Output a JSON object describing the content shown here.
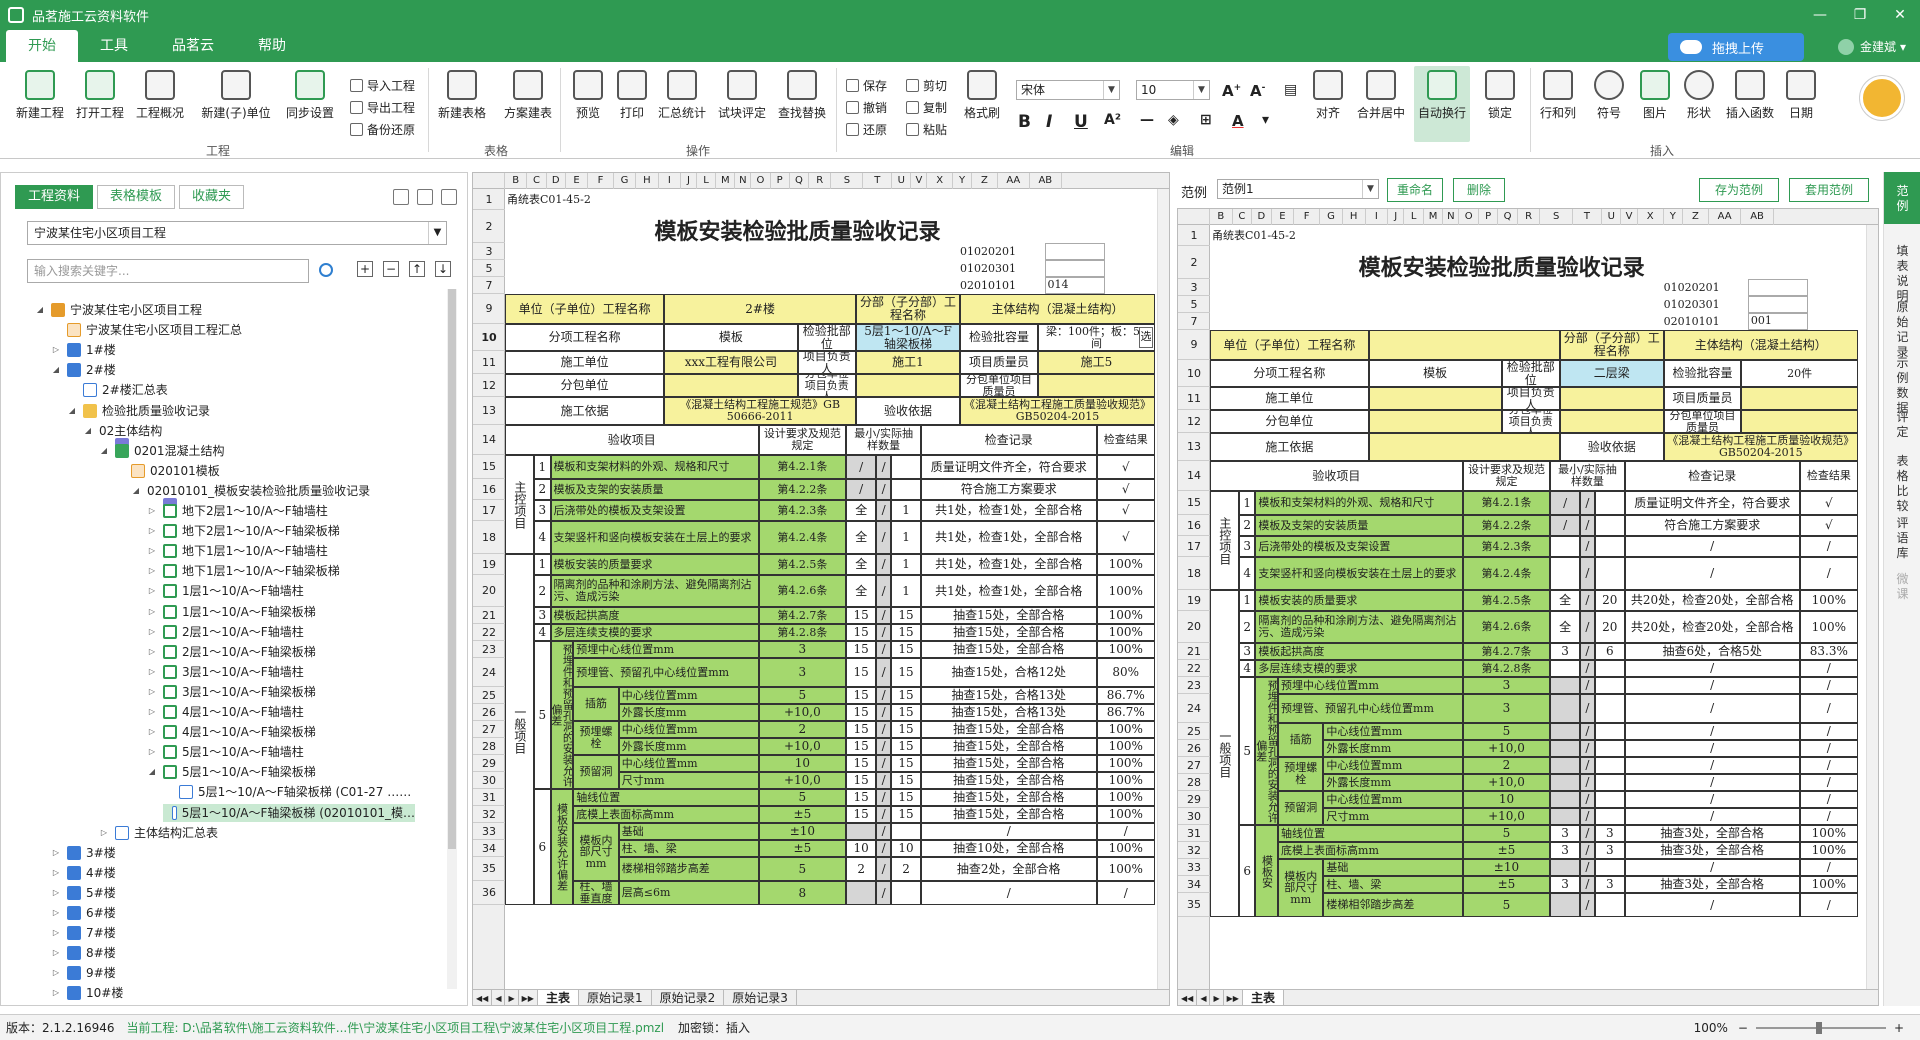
{
  "app": {
    "title": "品茗施工云资料软件"
  },
  "menu": {
    "tabs": [
      "开始",
      "工具",
      "品茗云",
      "帮助"
    ]
  },
  "upload": {
    "label": "拖拽上传"
  },
  "user": {
    "name": "金建斌"
  },
  "ribbon": {
    "big_buttons": [
      "新建工程",
      "打开工程",
      "工程概况",
      "新建(子)单位",
      "同步设置",
      "新建表格",
      "方案建表",
      "预览",
      "打印",
      "汇总统计",
      "试块评定",
      "查找替换",
      "格式刷",
      "对齐",
      "合并居中",
      "自动换行",
      "锁定",
      "行和列",
      "符号",
      "图片",
      "形状",
      "插入函数",
      "日期"
    ],
    "small_buttons": [
      "导入工程",
      "导出工程",
      "备份还原",
      "保存",
      "撤销",
      "还原",
      "剪切",
      "复制",
      "粘贴"
    ],
    "groups": [
      "工程",
      "表格",
      "操作",
      "编辑",
      "插入"
    ],
    "font_name": "宋体",
    "font_size": "10"
  },
  "left": {
    "tabs": [
      "工程资料",
      "表格模板",
      "收藏夹"
    ],
    "project": "宁波某住宅小区项目工程",
    "search_placeholder": "输入搜索关键字...",
    "tree": [
      "宁波某住宅小区项目工程",
      "宁波某住宅小区项目工程汇总",
      "1#楼",
      "2#楼",
      "2#楼汇总表",
      "检验批质量验收记录",
      "02主体结构",
      "0201混凝土结构",
      "020101模板",
      "02010101_模板安装检验批质量验收记录",
      "地下2层1～10/A～F轴墙柱",
      "地下2层1～10/A～F轴梁板梯",
      "地下1层1～10/A～F轴墙柱",
      "地下1层1～10/A～F轴梁板梯",
      "1层1～10/A～F轴墙柱",
      "1层1～10/A～F轴梁板梯",
      "2层1～10/A～F轴墙柱",
      "2层1～10/A～F轴梁板梯",
      "3层1～10/A～F轴墙柱",
      "3层1～10/A～F轴梁板梯",
      "4层1～10/A～F轴墙柱",
      "4层1～10/A～F轴梁板梯",
      "5层1～10/A～F轴墙柱",
      "5层1～10/A～F轴梁板梯",
      "5层1～10/A～F轴梁板梯 (C01-27 ……",
      "5层1～10/A～F轴梁板梯 (02010101_模…",
      "主体结构汇总表",
      "3#楼",
      "4#楼",
      "5#楼",
      "6#楼",
      "7#楼",
      "8#楼",
      "9#楼",
      "10#楼"
    ]
  },
  "sheetA": {
    "cols": [
      "B",
      "C",
      "D",
      "E",
      "F",
      "G",
      "H",
      "I",
      "J",
      "L",
      "M",
      "N",
      "O",
      "P",
      "Q",
      "R",
      "S",
      "T",
      "U",
      "V",
      "X",
      "Y",
      "Z",
      "AA",
      "AB"
    ],
    "rows": [
      "1",
      "2",
      "3",
      "5",
      "7",
      "9",
      "10",
      "11",
      "12",
      "13",
      "14",
      "15",
      "16",
      "17",
      "18",
      "19",
      "20",
      "21",
      "22",
      "23",
      "24",
      "25",
      "26",
      "27",
      "28",
      "29",
      "30",
      "31",
      "32",
      "33",
      "34",
      "35",
      "36"
    ],
    "code": "甬统表C01-45-2",
    "title": "模板安装检验批质量验收记录",
    "codes": [
      "01020201",
      "01020301",
      "02010101"
    ],
    "code_val": "014",
    "unit_lbl": "单位（子单位）工程名称",
    "unit_val": "2#楼",
    "sub_lbl": "分部（子分部）工程名称",
    "sub_val": "主体结构（混凝土结构）",
    "item_lbl": "分项工程名称",
    "item_val": "模板",
    "part_lbl": "检验批部位",
    "part_val": "5层1～10/A～F轴梁板梯",
    "cap_lbl": "检验批容量",
    "cap_val": "梁：100件；板：50间",
    "cap_btn": "选",
    "cons_lbl": "施工单位",
    "cons_val": "xxx工程有限公司",
    "pm_lbl": "项目负责人",
    "pm_val": "施工1",
    "qm_lbl": "项目质量员",
    "qm_val": "施工5",
    "subc_lbl": "分包单位",
    "subc_pm_lbl": "分包单位项目负责人",
    "subc_qm_lbl": "分包单位项目质量员",
    "basis_lbl": "施工依据",
    "basis_val": "《混凝土结构工程施工规范》GB 50666-2011",
    "accept_lbl": "验收依据",
    "accept_val": "《混凝土结构工程施工质量验收规范》GB50204-2015",
    "hdr": [
      "验收项目",
      "设计要求及规范规定",
      "最小/实际抽样数量",
      "检查记录",
      "检查结果"
    ],
    "main_lbl": "主控项目",
    "gen_lbl": "一般项目",
    "items": [
      [
        "1",
        "模板和支架材料的外观、规格和尺寸",
        "第4.2.1条",
        "/",
        "",
        "质量证明文件齐全，符合要求",
        "√"
      ],
      [
        "2",
        "模板及支架的安装质量",
        "第4.2.2条",
        "/",
        "",
        "符合施工方案要求",
        "√"
      ],
      [
        "3",
        "后浇带处的模板及支架设置",
        "第4.2.3条",
        "全",
        "1",
        "共1处，检查1处，全部合格",
        "√"
      ],
      [
        "4",
        "支架竖杆和竖向模板安装在土层上的要求",
        "第4.2.4条",
        "全",
        "1",
        "共1处，检查1处，全部合格",
        "√"
      ],
      [
        "1",
        "模板安装的质量要求",
        "第4.2.5条",
        "全",
        "1",
        "共1处，检查1处，全部合格",
        "100%"
      ],
      [
        "2",
        "隔离剂的品种和涂刷方法、避免隔离剂沾污、造成污染",
        "第4.2.6条",
        "全",
        "1",
        "共1处，检查1处，全部合格",
        "100%"
      ],
      [
        "3",
        "模板起拱高度",
        "第4.2.7条",
        "15",
        "15",
        "抽查15处，全部合格",
        "100%"
      ],
      [
        "4",
        "多层连续支模的要求",
        "第4.2.8条",
        "15",
        "15",
        "抽查15处，全部合格",
        "100%"
      ]
    ],
    "g5_lbl": "预埋件和预留孔洞的安装允许偏差",
    "g5_no": "5",
    "g6_lbl": "模板安装允许偏差",
    "g6_no": "6",
    "dev": [
      [
        "预埋中心线位置mm",
        "3",
        "15",
        "15",
        "抽查15处，全部合格",
        "100%"
      ],
      [
        "预埋管、预留孔中心线位置mm",
        "3",
        "15",
        "15",
        "抽查15处，合格12处",
        "80%"
      ],
      [
        "插筋",
        "中心线位置mm",
        "5",
        "15",
        "15",
        "抽查15处，合格13处",
        "86.7%"
      ],
      [
        "",
        "外露长度mm",
        "+10,0",
        "15",
        "15",
        "抽查15处，合格13处",
        "86.7%"
      ],
      [
        "预埋螺栓",
        "中心线位置mm",
        "2",
        "15",
        "15",
        "抽查15处，全部合格",
        "100%"
      ],
      [
        "",
        "外露长度mm",
        "+10,0",
        "15",
        "15",
        "抽查15处，全部合格",
        "100%"
      ],
      [
        "预留洞",
        "中心线位置mm",
        "10",
        "15",
        "15",
        "抽查15处，全部合格",
        "100%"
      ],
      [
        "",
        "尺寸mm",
        "+10,0",
        "15",
        "15",
        "抽查15处，全部合格",
        "100%"
      ],
      [
        "轴线位置",
        "",
        "5",
        "15",
        "15",
        "抽查15处，全部合格",
        "100%"
      ],
      [
        "底模上表面标高mm",
        "",
        "±5",
        "15",
        "15",
        "抽查15处，全部合格",
        "100%"
      ],
      [
        "模板内部尺寸mm",
        "基础",
        "±10",
        "",
        "",
        "/",
        "/"
      ],
      [
        "",
        "柱、墙、梁",
        "±5",
        "10",
        "10",
        "抽查10处，全部合格",
        "100%"
      ],
      [
        "",
        "楼梯相邻踏步高差",
        "5",
        "2",
        "2",
        "抽查2处，全部合格",
        "100%"
      ],
      [
        "柱、墙垂直度",
        "层高≤6m",
        "8",
        "",
        "",
        "/",
        "/"
      ]
    ],
    "tabs": [
      "主表",
      "原始记录1",
      "原始记录2",
      "原始记录3"
    ]
  },
  "sheetB": {
    "toolbar_label": "范例",
    "combo": "范例1",
    "buttons": [
      "重命名",
      "删除",
      "存为范例",
      "套用范例"
    ],
    "cols": [
      "B",
      "C",
      "D",
      "E",
      "F",
      "G",
      "H",
      "I",
      "J",
      "L",
      "M",
      "N",
      "O",
      "P",
      "Q",
      "R",
      "S",
      "T",
      "U",
      "V",
      "X",
      "Y",
      "Z",
      "AA",
      "AB"
    ],
    "rows": [
      "1",
      "2",
      "3",
      "5",
      "7",
      "9",
      "10",
      "11",
      "12",
      "13",
      "14",
      "15",
      "16",
      "17",
      "18",
      "19",
      "20",
      "21",
      "22",
      "23",
      "24",
      "25",
      "26",
      "27",
      "28",
      "29",
      "30",
      "31",
      "32",
      "33",
      "34",
      "35"
    ],
    "code": "甬统表C01-45-2",
    "title": "模板安装检验批质量验收记录",
    "codes": [
      "01020201",
      "01020301",
      "02010101"
    ],
    "code_val": "001",
    "part_val": "二层梁",
    "cap_val": "20件",
    "items": [
      [
        "1",
        "模板和支架材料的外观、规格和尺寸",
        "第4.2.1条",
        "/",
        "",
        "质量证明文件齐全，符合要求",
        "√"
      ],
      [
        "2",
        "模板及支架的安装质量",
        "第4.2.2条",
        "/",
        "",
        "符合施工方案要求",
        "√"
      ],
      [
        "3",
        "后浇带处的模板及支架设置",
        "第4.2.3条",
        "",
        "",
        "/",
        "/"
      ],
      [
        "4",
        "支架竖杆和竖向模板安装在土层上的要求",
        "第4.2.4条",
        "",
        "",
        "/",
        "/"
      ],
      [
        "1",
        "模板安装的质量要求",
        "第4.2.5条",
        "全",
        "20",
        "共20处，检查20处，全部合格",
        "100%"
      ],
      [
        "2",
        "隔离剂的品种和涂刷方法、避免隔离剂沾污、造成污染",
        "第4.2.6条",
        "全",
        "20",
        "共20处，检查20处，全部合格",
        "100%"
      ],
      [
        "3",
        "模板起拱高度",
        "第4.2.7条",
        "3",
        "6",
        "抽查6处，合格5处",
        "83.3%"
      ],
      [
        "4",
        "多层连续支模的要求",
        "第4.2.8条",
        "",
        "",
        "/",
        "/"
      ]
    ],
    "dev": [
      [
        "预埋中心线位置mm",
        "3",
        "",
        "",
        "/",
        "/"
      ],
      [
        "预埋管、预留孔中心线位置mm",
        "3",
        "",
        "",
        "/",
        "/"
      ],
      [
        "插筋",
        "中心线位置mm",
        "5",
        "",
        "",
        "/",
        "/"
      ],
      [
        "",
        "外露长度mm",
        "+10,0",
        "",
        "",
        "/",
        "/"
      ],
      [
        "预埋螺栓",
        "中心线位置mm",
        "2",
        "",
        "",
        "/",
        "/"
      ],
      [
        "",
        "外露长度mm",
        "+10,0",
        "",
        "",
        "/",
        "/"
      ],
      [
        "预留洞",
        "中心线位置mm",
        "10",
        "",
        "",
        "/",
        "/"
      ],
      [
        "",
        "尺寸mm",
        "+10,0",
        "",
        "",
        "/",
        "/"
      ],
      [
        "轴线位置",
        "",
        "5",
        "3",
        "3",
        "抽查3处，全部合格",
        "100%"
      ],
      [
        "底模上表面标高mm",
        "",
        "±5",
        "3",
        "3",
        "抽查3处，全部合格",
        "100%"
      ],
      [
        "模板内部尺寸mm",
        "基础",
        "±10",
        "",
        "",
        "/",
        "/"
      ],
      [
        "",
        "柱、墙、梁",
        "±5",
        "3",
        "3",
        "抽查3处，全部合格",
        "100%"
      ],
      [
        "",
        "楼梯相邻踏步高差",
        "5",
        "",
        "",
        "/",
        "/"
      ]
    ],
    "g6_lbl": "模板安",
    "tabs": [
      "主表"
    ]
  },
  "vtabs": [
    "范例",
    "填表说明",
    "原始记录",
    "示例数据",
    "评定",
    "表格比较",
    "评语库",
    "微课"
  ],
  "status": {
    "version": "版本：2.1.2.16946",
    "path": "当前工程: D:\\品茗软件\\施工云资料软件...件\\宁波某住宅小区项目工程\\宁波某住宅小区项目工程.pmzl",
    "lock": "加密锁：插入",
    "zoom": "100%"
  },
  "colors": {
    "brand": "#2f9a52",
    "yellow": "#f7f29d",
    "green": "#a4d86e",
    "blue": "#bfe6f2"
  }
}
